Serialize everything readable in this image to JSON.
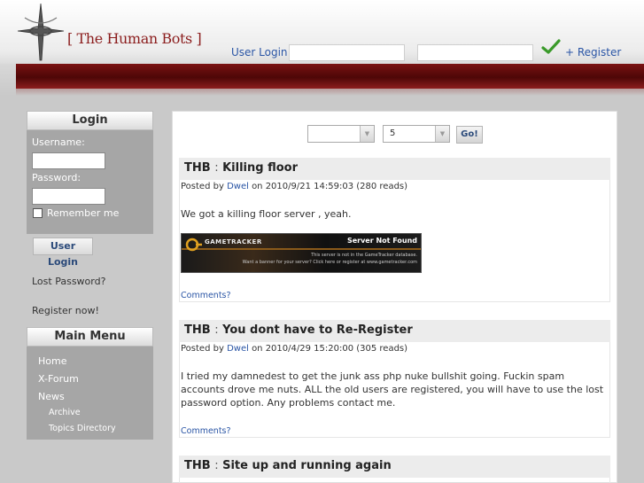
{
  "header": {
    "site_title": "[ The Human Bots ]",
    "login_link": "User Login",
    "register_link": "+ Register"
  },
  "login_block": {
    "title": "Login",
    "username_label": "Username:",
    "password_label": "Password:",
    "remember_label": "Remember me",
    "login_button": "User Login",
    "lost_password": "Lost Password?",
    "register_now": "Register now!"
  },
  "main_menu": {
    "title": "Main Menu",
    "items": [
      "Home",
      "X-Forum",
      "News"
    ],
    "sub_items": [
      "Archive",
      "Topics Directory"
    ]
  },
  "filter": {
    "topic_value": "",
    "count_value": "5",
    "go_button": "Go!"
  },
  "stories": [
    {
      "topic": "THB",
      "separator": ":",
      "title": "Killing floor",
      "posted_by": "Posted by",
      "poster": "Dwel",
      "date_reads": "on 2010/9/21 14:59:03 (280 reads)",
      "text": "We got a killing floor server , yeah.",
      "comments": "Comments?"
    },
    {
      "topic": "THB",
      "separator": ":",
      "title": "You dont have to Re-Register",
      "posted_by": "Posted by",
      "poster": "Dwel",
      "date_reads": "on 2010/4/29 15:20:00 (305 reads)",
      "text": "I tried my damnedest to get the junk ass php nuke bullshit going. Fuckin spam accounts drove me nuts. ALL the old users are registered, you will have to use the lost password option. Any problems contact me.",
      "comments": "Comments?"
    },
    {
      "topic": "THB",
      "separator": ":",
      "title": "Site up and running again"
    }
  ],
  "banner": {
    "brand": "GAMETRACKER",
    "status": "Server Not Found",
    "note1": "This server is not in the GameTracker database.",
    "note2": "Want a banner for your server? Click here or register at www.gametracker.com"
  },
  "colors": {
    "accent_red": "#7a1212",
    "link_blue": "#2a55a5",
    "sidebar_grey": "#a6a6a6"
  }
}
